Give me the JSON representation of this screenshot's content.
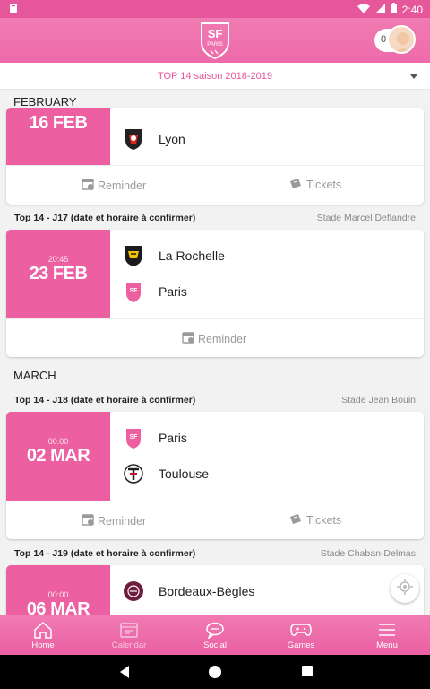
{
  "status_bar": {
    "time": "2:40"
  },
  "header": {
    "logo_text": "SF",
    "logo_sub": "PARIS",
    "notification_count": "0"
  },
  "season_selector": {
    "label": "TOP 14 saison 2018-2019"
  },
  "sections": [
    {
      "month": "FEBRUARY"
    },
    {
      "month": "MARCH"
    }
  ],
  "matches": [
    {
      "day": "16 FEB",
      "teams": [
        {
          "name": "Lyon",
          "crest": "lyon-crest-icon"
        }
      ],
      "actions": [
        "Reminder",
        "Tickets"
      ]
    },
    {
      "header": "Top 14 - J17 (date et horaire à confirmer)",
      "stadium": "Stade Marcel Deflandre",
      "time": "20:45",
      "day": "23 FEB",
      "teams": [
        {
          "name": "La Rochelle",
          "crest": "la-rochelle-crest-icon"
        },
        {
          "name": "Paris",
          "crest": "paris-crest-icon"
        }
      ],
      "actions": [
        "Reminder"
      ]
    },
    {
      "header": "Top 14 - J18 (date et horaire à confirmer)",
      "stadium": "Stade Jean Bouin",
      "time": "00:00",
      "day": "02 MAR",
      "teams": [
        {
          "name": "Paris",
          "crest": "paris-crest-icon"
        },
        {
          "name": "Toulouse",
          "crest": "toulouse-crest-icon"
        }
      ],
      "actions": [
        "Reminder",
        "Tickets"
      ]
    },
    {
      "header": "Top 14 - J19 (date et horaire à confirmer)",
      "stadium": "Stade Chaban-Delmas",
      "time": "00:00",
      "day": "06 MAR",
      "teams": [
        {
          "name": "Bordeaux-Bègles",
          "crest": "bordeaux-crest-icon"
        }
      ]
    }
  ],
  "bottom_nav": [
    {
      "label": "Home",
      "icon": "home-icon"
    },
    {
      "label": "Calendar",
      "icon": "calendar-icon",
      "active": true
    },
    {
      "label": "Social",
      "icon": "chat-icon"
    },
    {
      "label": "Games",
      "icon": "gamepad-icon"
    },
    {
      "label": "Menu",
      "icon": "menu-icon"
    }
  ],
  "colors": {
    "brand_pink": "#ec5fa0",
    "season_text": "#e5579a"
  }
}
